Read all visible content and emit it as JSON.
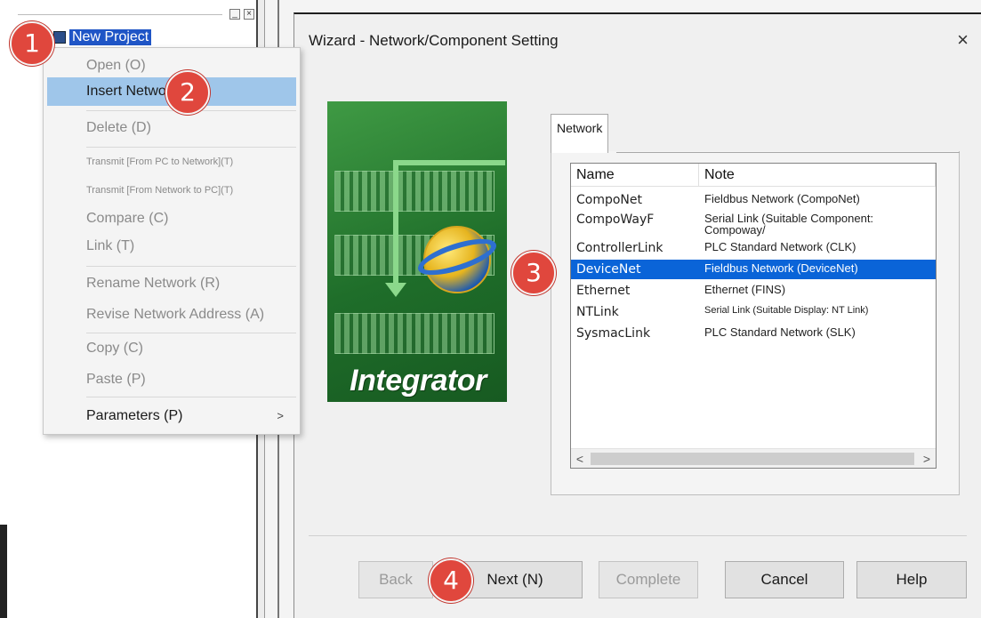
{
  "project_tree": {
    "root_label": "New Project",
    "toolbar_buttons": [
      "_",
      "×"
    ]
  },
  "context_menu": {
    "items": [
      {
        "label": "Open (O)"
      },
      {
        "label": "Insert Network (I)"
      },
      {
        "label": "Delete (D)"
      },
      {
        "label": "Transmit [From PC to Network](T)"
      },
      {
        "label": "Transmit [From Network to PC](T)"
      },
      {
        "label": "Compare (C)"
      },
      {
        "label": "Link (T)"
      },
      {
        "label": "Rename Network (R)"
      },
      {
        "label": "Revise Network Address (A)"
      },
      {
        "label": "Copy (C)"
      },
      {
        "label": "Paste (P)"
      },
      {
        "label": "Parameters (P)",
        "submenu_arrow": ">"
      }
    ]
  },
  "wizard": {
    "title": "Wizard - Network/Component Setting",
    "close_glyph": "×",
    "logo_text": "Integrator",
    "tab_label": "Network",
    "list": {
      "columns": [
        "Name",
        "Note"
      ],
      "rows": [
        {
          "name": "CompoNet",
          "note": "Fieldbus Network  (CompoNet)"
        },
        {
          "name": "CompoWayF",
          "note": "Serial Link (Suitable Component: Compoway/"
        },
        {
          "name": "ControllerLink",
          "note": "PLC Standard Network (CLK)"
        },
        {
          "name": "DeviceNet",
          "note": "Fieldbus Network (DeviceNet)"
        },
        {
          "name": "Ethernet",
          "note": "Ethernet (FINS)"
        },
        {
          "name": "NTLink",
          "note": "Serial Link (Suitable Display: NT Link)"
        },
        {
          "name": "SysmacLink",
          "note": "PLC Standard Network (SLK)"
        }
      ],
      "selected": "DeviceNet",
      "scroll_left": "<",
      "scroll_right": ">"
    },
    "buttons": {
      "back": "Back",
      "next": "Next (N)",
      "complete": "Complete",
      "cancel": "Cancel",
      "help": "Help"
    }
  },
  "step_badges": [
    "1",
    "2",
    "3",
    "4"
  ],
  "colors": {
    "selection": "#0a64d8",
    "menu_hover": "#9fc6ea",
    "badge": "#e0473d",
    "tree_selection": "#1f55c6"
  }
}
